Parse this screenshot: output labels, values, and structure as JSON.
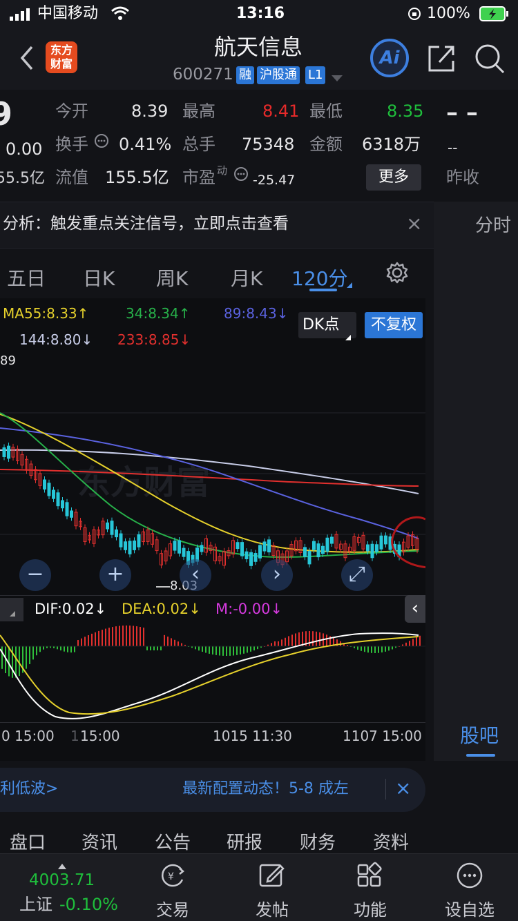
{
  "status_bar": {
    "carrier": "中国移动",
    "time": "13:16",
    "battery": "100%"
  },
  "nav": {
    "back_icon": "chevron-left-icon",
    "logo_text_1": "东方",
    "logo_text_2": "财富",
    "title": "航天信息",
    "code": "600271",
    "tags": [
      "融",
      "沪股通",
      "L1"
    ],
    "ai_label": "Ai",
    "share_icon": "share-icon",
    "search_icon": "search-icon"
  },
  "quote": {
    "price_partial": "9",
    "change": "0.00",
    "mktcap_partial": "55.5亿",
    "rows": [
      [
        {
          "label": "今开",
          "value": "8.39"
        },
        {
          "label": "最高",
          "value": "8.41"
        },
        {
          "label": "最低",
          "value": "8.35"
        }
      ],
      [
        {
          "label": "换手",
          "value": "0.41%"
        },
        {
          "label": "总手",
          "value": "75348"
        },
        {
          "label": "金额",
          "value": "6318万"
        }
      ],
      [
        {
          "label": "流值",
          "value": "155.5亿"
        },
        {
          "label": "市盈",
          "value": "-25.47"
        }
      ]
    ],
    "pe_superscript": "动",
    "more_button": "更多",
    "right_dash_1": "– –",
    "right_dash_2": "--",
    "prev_close_label": "昨收",
    "colors": {
      "high": "#e62a2a",
      "low": "#1fbf3c"
    }
  },
  "banner": {
    "text": "分析：触发重点关注信号，立即点击查看",
    "close": "×"
  },
  "side": {
    "fenshi": "分时",
    "guba": "股吧"
  },
  "tabs": {
    "items": [
      "五日",
      "日K",
      "周K",
      "月K",
      "120分"
    ],
    "active_index": 4,
    "settings_icon": "gear-icon"
  },
  "ma_legend": {
    "ma55": "MA55:8.33↑",
    "ma34": "34:8.34↑",
    "ma89": "89:8.43↓",
    "ma144": "144:8.80↓",
    "ma233": "233:8.85↓",
    "colors": {
      "ma55": "#e6d12c",
      "ma34": "#27b14a",
      "ma89": "#5a62e0",
      "ma144": "#c8cde8",
      "ma233": "#e2302e"
    }
  },
  "chart_buttons": {
    "dk": "DK点",
    "fuquan": "不复权"
  },
  "chart": {
    "top_price": "89",
    "low_label": "8.03",
    "xlabels": [
      "0 15:00",
      "1",
      "15:00",
      "1015 11:30",
      "1107 15:00"
    ]
  },
  "macd": {
    "dif": "DIF:0.02↓",
    "dea": "DEA:0.02↓",
    "m": "M:-0.00↓",
    "colors": {
      "dif": "#ffffff",
      "dea": "#e6d12c",
      "m": "#d63adf"
    }
  },
  "promo": {
    "left": "利低波>",
    "right": "最新配置动态！5-8 成左",
    "close": "×"
  },
  "subtabs": [
    "盘口",
    "资讯",
    "公告",
    "研报",
    "财务",
    "资料"
  ],
  "tabbar": {
    "index_value": "4003.71",
    "index_name": "上证",
    "index_change": "-0.10%",
    "items": [
      {
        "label": "交易",
        "icon": "yen-refresh-icon"
      },
      {
        "label": "发帖",
        "icon": "edit-icon"
      },
      {
        "label": "功能",
        "icon": "grid-icon"
      },
      {
        "label": "设自选",
        "icon": "more-circle-icon"
      }
    ]
  }
}
